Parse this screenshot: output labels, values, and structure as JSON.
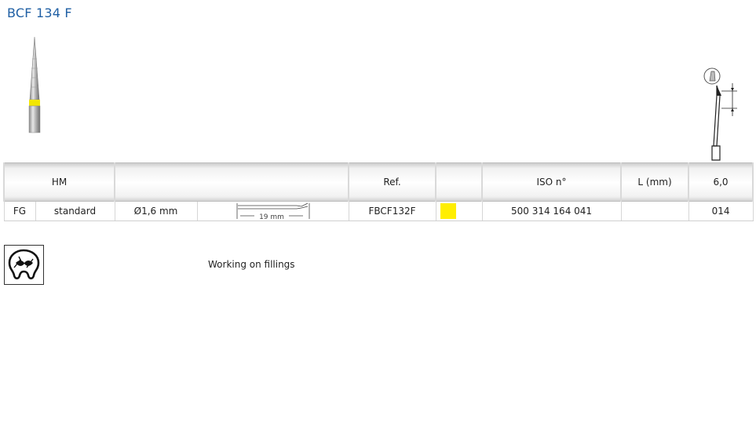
{
  "product": {
    "title": "BCF 134 F"
  },
  "table": {
    "header": {
      "material": "HM",
      "ref_label": "Ref.",
      "iso_label": "ISO n°",
      "length_label": "L (mm)",
      "size": "6,0"
    },
    "row": {
      "shank": "FG",
      "length_type": "standard",
      "shank_diameter": "Ø1,6 mm",
      "total_length": "19 mm",
      "ref": "FBCF132F",
      "color_code": "#ffee00",
      "iso": "500 314 164 041",
      "length": "",
      "size_code": "014"
    }
  },
  "application": {
    "icon": "filling-tooth-icon",
    "label": "Working on fillings"
  }
}
